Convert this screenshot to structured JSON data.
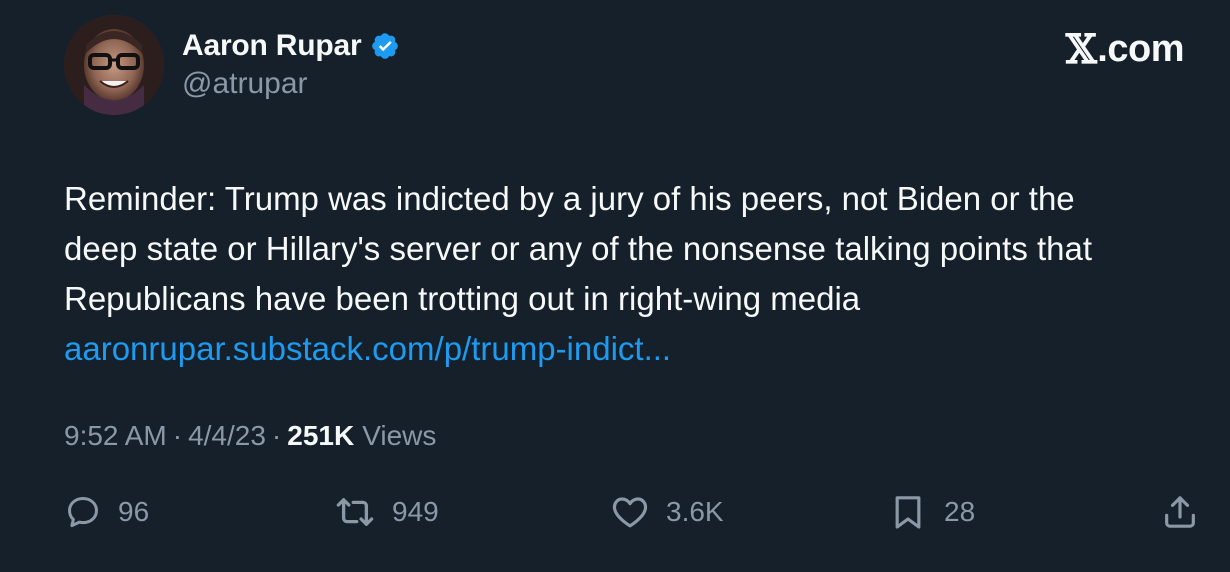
{
  "author": {
    "display_name": "Aaron Rupar",
    "handle": "@atrupar",
    "verified": true
  },
  "brand": {
    "label": ".com",
    "glyph": "𝕏"
  },
  "tweet": {
    "lines": [
      "Reminder: Trump was indicted by a jury of his peers, not Biden or the",
      "deep state or Hillary's server or any of the nonsense talking points that",
      "Republicans have been trotting out in right-wing media"
    ],
    "link_text": "aaronrupar.substack.com/p/trump-indict..."
  },
  "meta": {
    "time": "9:52 AM",
    "separator": "·",
    "date": "4/4/23",
    "views_count": "251K",
    "views_label": "Views"
  },
  "actions": {
    "replies": "96",
    "retweets": "949",
    "likes": "3.6K",
    "bookmarks": "28"
  },
  "colors": {
    "background": "#15202b",
    "text_primary": "#f7f9f9",
    "text_secondary": "#8b98a5",
    "link": "#1d9bf0",
    "verified_badge": "#1d9bf0"
  },
  "icons": {
    "reply": "speech-bubble-icon",
    "retweet": "retweet-icon",
    "like": "heart-icon",
    "bookmark": "bookmark-icon",
    "share": "share-upload-icon",
    "verified": "verified-badge-icon"
  }
}
